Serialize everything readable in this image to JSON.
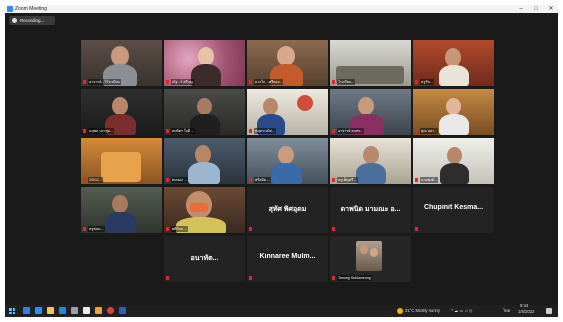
{
  "window": {
    "title": "Zoom Meeting",
    "minimize": "–",
    "maximize": "□",
    "close": "✕"
  },
  "recording": {
    "label": "Recording..."
  },
  "tiles": [
    {
      "name": "อาจารย์...ไร้ระเบียบ"
    },
    {
      "name": "ณัฐ...ร์ ศรีบุญ"
    },
    {
      "name": "ดวงใจ ...ศรีทอง..."
    },
    {
      "name": "โรงเรียน..."
    },
    {
      "name": "ครูรัช..."
    },
    {
      "name": "นฤพล ประชุม..."
    },
    {
      "name": "สมจิตร ใจดี ..."
    },
    {
      "name": "หมุดระเบิด..."
    },
    {
      "name": "อาจารย์ ธนพร..."
    },
    {
      "name": "คุณ ลดา..."
    },
    {
      "name": "20012..."
    },
    {
      "name": "สมปอง ..."
    },
    {
      "name": "ศรีสมัย ..."
    },
    {
      "name": "ครูเพ็ญศรี ..."
    },
    {
      "name": "นายพงศ์..."
    },
    {
      "name": "ครูพนม..."
    },
    {
      "name": "ศศิวิมล ..."
    },
    {
      "name": "สุทัศ พิศอุดม",
      "big": "สุทัศ พิศอุดม"
    },
    {
      "name": "ดาพนิด มามณะ อ...",
      "big": "ดาพนิด มามณะ อ..."
    },
    {
      "name": "Chupinit Kesma...",
      "big": "Chupinit Kesma..."
    },
    {
      "name": "อนาทัต...",
      "big": "อนาทัต..."
    },
    {
      "name": "Kinnaree Mulm...",
      "big": "Kinnaree Mulm..."
    },
    {
      "name": "Tanong Sukkaneung"
    }
  ],
  "taskbar": {
    "weather": "31°C  Mostly sunny",
    "lang": "ไทย",
    "time": "9:34",
    "date": "1/8/2022"
  },
  "colors": {
    "accent": "#2d8cff",
    "active_speaker": "#d7e05a",
    "muted": "#e0282e",
    "background": "#1a1a1a"
  }
}
